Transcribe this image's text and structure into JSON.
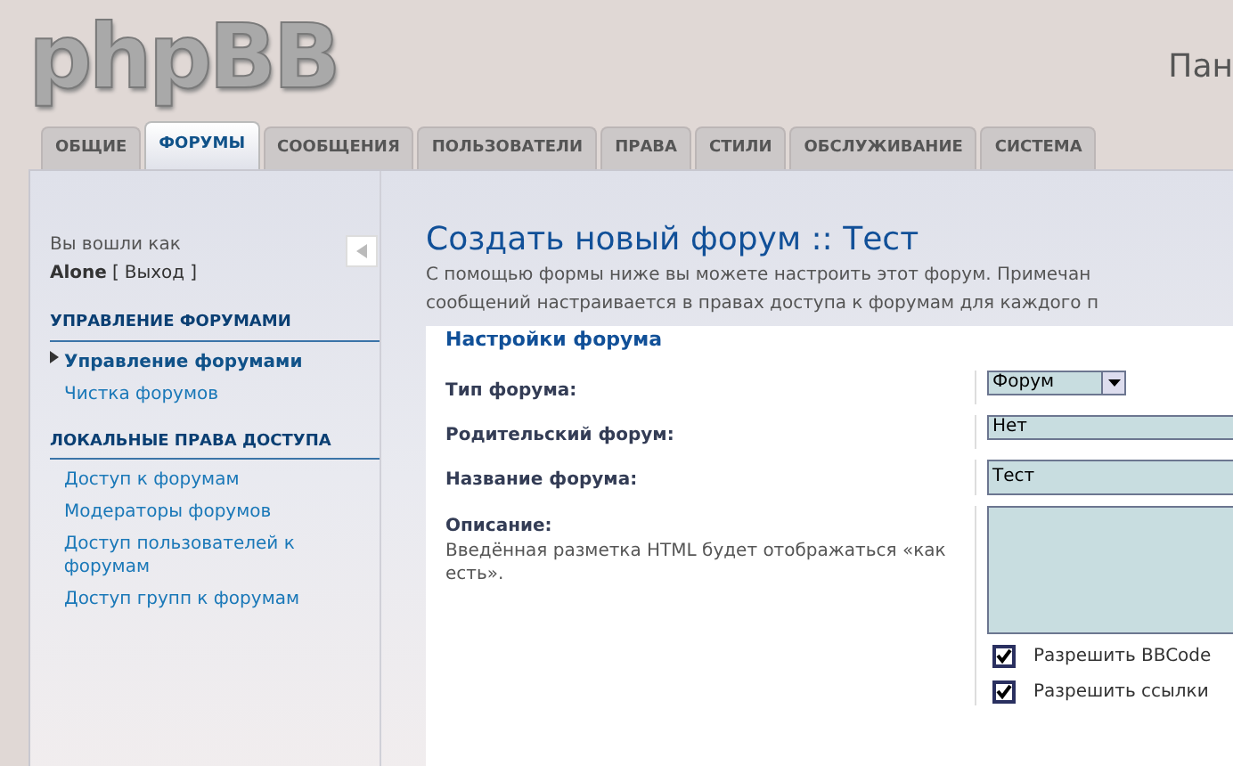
{
  "logo": "phpBB",
  "header_text": "Пан",
  "tabs": [
    {
      "label": "ОБЩИЕ",
      "selected": false
    },
    {
      "label": "ФОРУМЫ",
      "selected": true
    },
    {
      "label": "СООБЩЕНИЯ",
      "selected": false
    },
    {
      "label": "ПОЛЬЗОВАТЕЛИ",
      "selected": false
    },
    {
      "label": "ПРАВА",
      "selected": false
    },
    {
      "label": "СТИЛИ",
      "selected": false
    },
    {
      "label": "ОБСЛУЖИВАНИЕ",
      "selected": false
    },
    {
      "label": "СИСТЕМА",
      "selected": false
    }
  ],
  "sidebar": {
    "logged_in_as": "Вы вошли как",
    "user": "Alone",
    "logout": "Выход",
    "bracket_open": "[",
    "bracket_close": "]",
    "sections": [
      {
        "title": "УПРАВЛЕНИЕ ФОРУМАМИ",
        "items": [
          {
            "label": "Управление форумами",
            "selected": true
          },
          {
            "label": "Чистка форумов",
            "selected": false
          }
        ]
      },
      {
        "title": "ЛОКАЛЬНЫЕ ПРАВА ДОСТУПА",
        "items": [
          {
            "label": "Доступ к форумам",
            "selected": false
          },
          {
            "label": "Модераторы форумов",
            "selected": false
          },
          {
            "label": "Доступ пользователей к форумам",
            "selected": false
          },
          {
            "label": "Доступ групп к форумам",
            "selected": false
          }
        ]
      }
    ]
  },
  "main": {
    "title": "Создать новый форум :: Тест",
    "intro": [
      "С помощью формы ниже вы можете настроить этот форум. Примечан",
      "сообщений настраивается в правах доступа к форумам для каждого п"
    ],
    "fieldset": {
      "legend": "Настройки форума",
      "fields": [
        {
          "kind": "select",
          "label": "Тип форума:",
          "value": "Форум",
          "wide": false
        },
        {
          "kind": "select",
          "label": "Родительский форум:",
          "value": "Нет",
          "wide": true
        },
        {
          "kind": "text",
          "label": "Название форума:",
          "value": "Тест"
        },
        {
          "kind": "textarea",
          "label": "Описание:",
          "hint": "Введённая разметка HTML будет отображаться «как есть».",
          "options": [
            {
              "label": "Разрешить BBCode",
              "checked": true
            },
            {
              "label": "Разрешить ссылки",
              "checked": true
            }
          ]
        }
      ]
    }
  }
}
